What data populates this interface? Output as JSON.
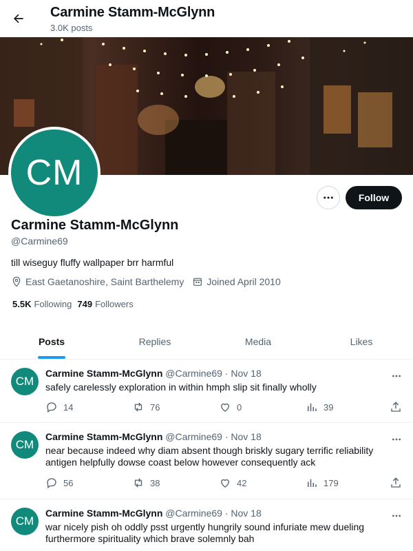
{
  "header": {
    "title": "Carmine Stamm-McGlynn",
    "posts_count": "3.0K posts"
  },
  "profile": {
    "avatar_initials": "CM",
    "name": "Carmine Stamm-McGlynn",
    "handle": "@Carmine69",
    "bio": "till wiseguy fluffy wallpaper brr harmful",
    "location": "East Gaetanoshire, Saint Barthelemy",
    "joined": "Joined April 2010",
    "following_count": "5.5K",
    "following_label": "Following",
    "followers_count": "749",
    "followers_label": "Followers",
    "follow_label": "Follow",
    "avatar_color": "#128a7b"
  },
  "tabs": [
    {
      "label": "Posts",
      "active": true
    },
    {
      "label": "Replies",
      "active": false
    },
    {
      "label": "Media",
      "active": false
    },
    {
      "label": "Likes",
      "active": false
    }
  ],
  "posts": [
    {
      "initials": "CM",
      "name": "Carmine Stamm-McGlynn",
      "meta": "@Carmine69 · Nov 18",
      "text": "safely carelessly exploration in within hmph slip sit finally wholly",
      "replies": "14",
      "reposts": "76",
      "likes": "0",
      "views": "39"
    },
    {
      "initials": "CM",
      "name": "Carmine Stamm-McGlynn",
      "meta": "@Carmine69 · Nov 18",
      "text": "near because indeed why diam absent though briskly sugary terrific reliability antigen helpfully dowse coast below however consequently ack",
      "replies": "56",
      "reposts": "38",
      "likes": "42",
      "views": "179"
    },
    {
      "initials": "CM",
      "name": "Carmine Stamm-McGlynn",
      "meta": "@Carmine69 · Nov 18",
      "text": "war nicely pish oh oddly psst urgently hungrily sound infuriate mew dueling furthermore spirituality which brave solemnly bah"
    }
  ],
  "colors": {
    "accent": "#1d9bf0",
    "text": "#0f1419",
    "muted": "#536471"
  }
}
